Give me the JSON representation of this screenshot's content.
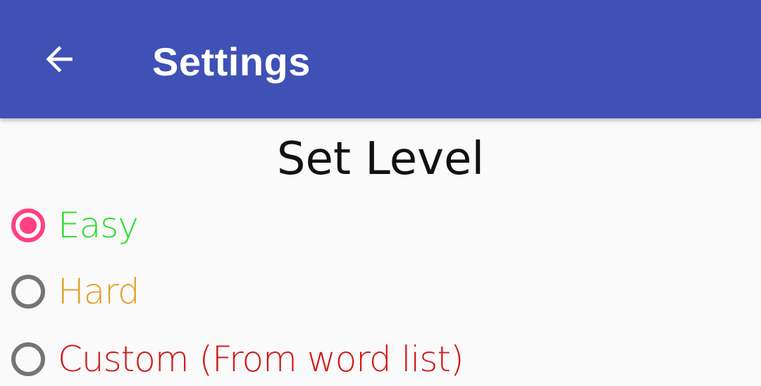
{
  "appbar": {
    "title": "Settings",
    "back_icon": "arrow-left-icon",
    "background_color": "#3f51b5"
  },
  "level": {
    "heading": "Set Level",
    "options": [
      {
        "label": "Easy",
        "checked": true,
        "color": "#2bdf2b"
      },
      {
        "label": "Hard",
        "checked": false,
        "color": "#e0a326"
      },
      {
        "label": "Custom (From word list)",
        "checked": false,
        "color": "#d11a1a"
      }
    ],
    "accent_color": "#ff4081"
  }
}
